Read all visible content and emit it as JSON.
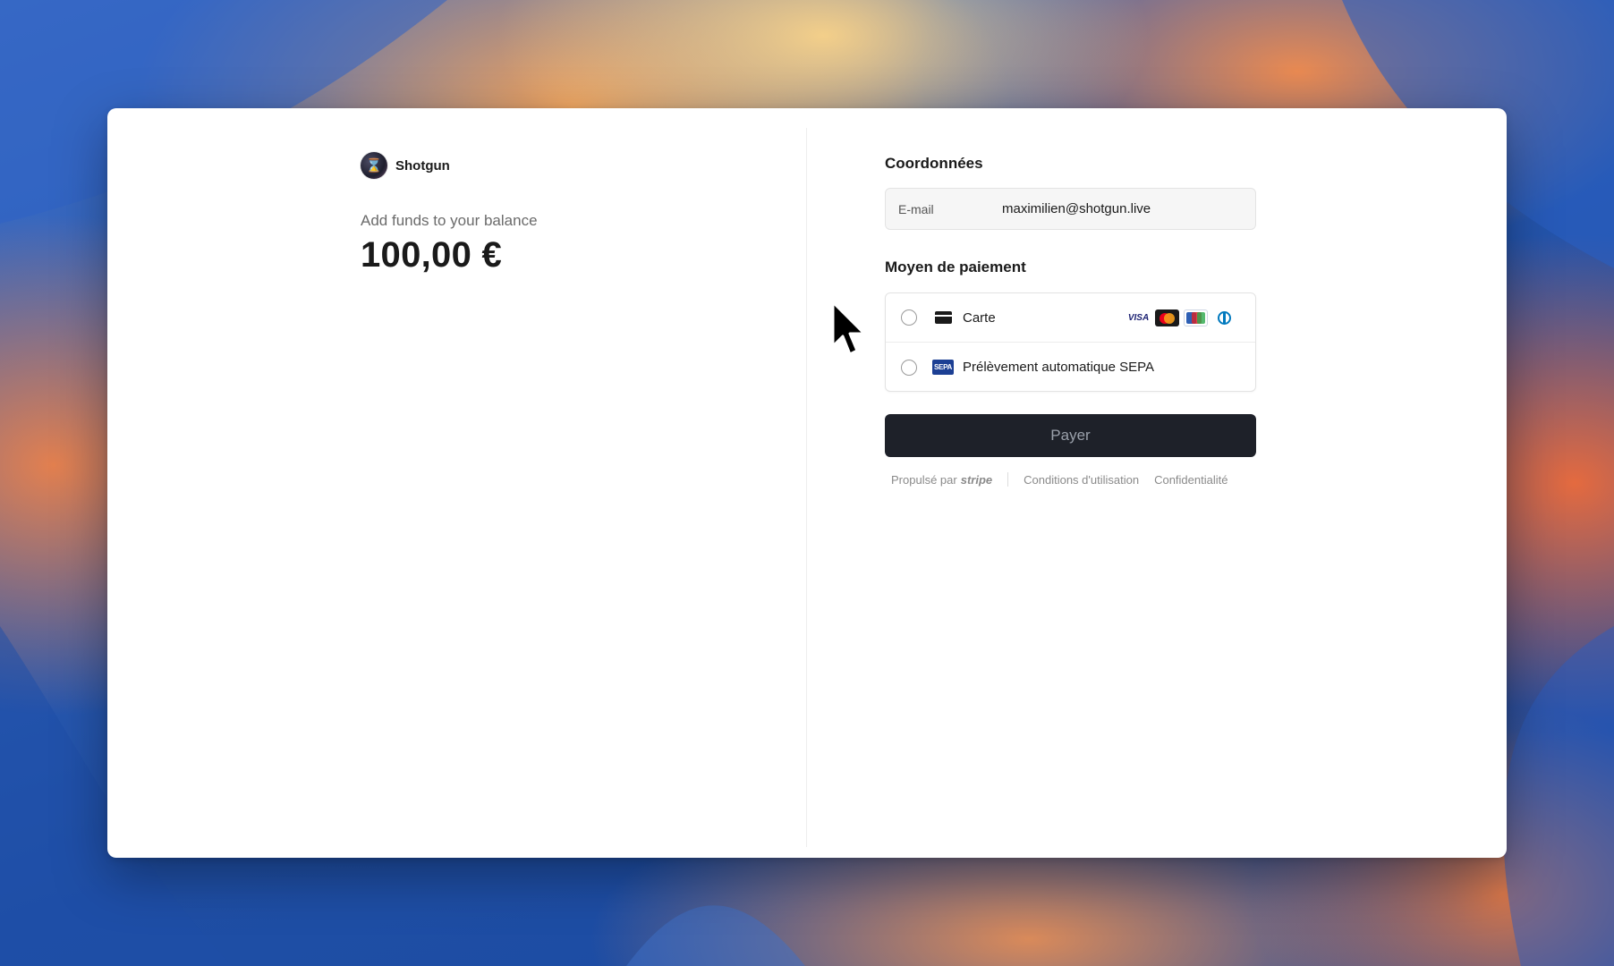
{
  "brand": {
    "name": "Shotgun",
    "logo_glyph": "⌛"
  },
  "summary": {
    "subtitle": "Add funds to your balance",
    "amount": "100,00 €"
  },
  "contact": {
    "title": "Coordonnées",
    "email_label": "E-mail",
    "email_value": "maximilien@shotgun.live"
  },
  "payment": {
    "title": "Moyen de paiement",
    "methods": [
      {
        "label": "Carte",
        "icon": "card-icon",
        "brands": [
          "VISA",
          "Mastercard",
          "CB",
          "Diners Club"
        ]
      },
      {
        "label": "Prélèvement automatique SEPA",
        "icon": "sepa-icon",
        "badge": "SEPA"
      }
    ],
    "card_brand_visa": "VISA",
    "sepa_badge": "SEPA",
    "pay_label": "Payer"
  },
  "footer": {
    "powered_by": "Propulsé par",
    "stripe": "stripe",
    "terms": "Conditions d'utilisation",
    "privacy": "Confidentialité"
  },
  "colors": {
    "button_bg": "#1e2129",
    "text_primary": "#1a1a1a",
    "text_muted": "#6b6b6b"
  }
}
